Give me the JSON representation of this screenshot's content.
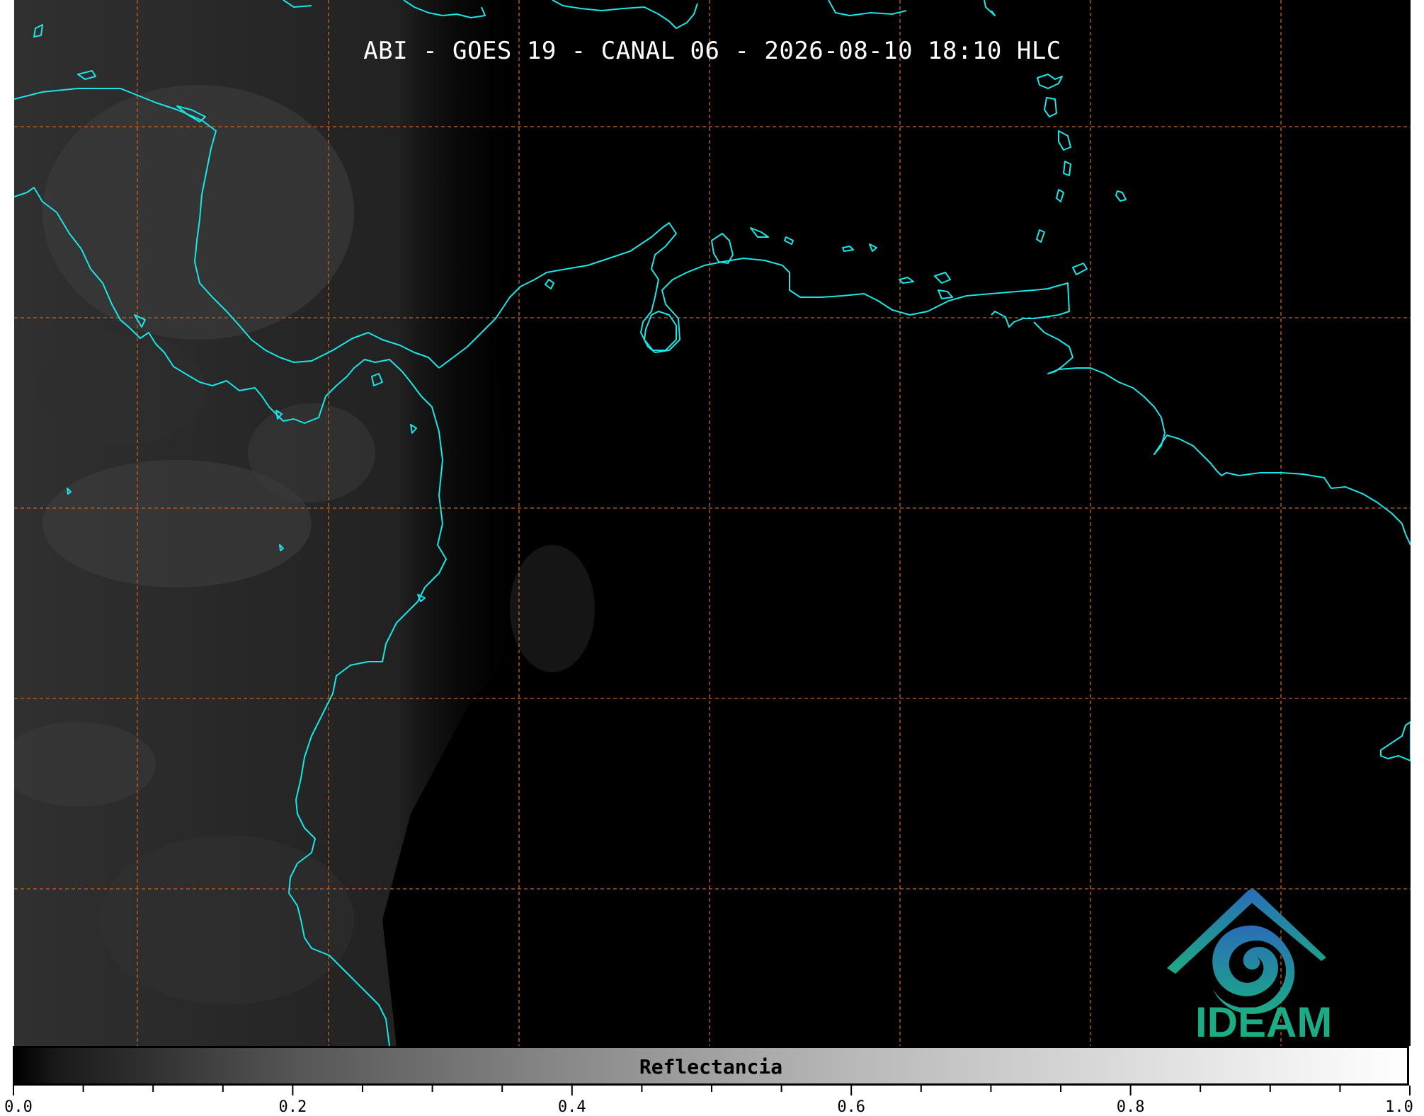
{
  "title": "ABI - GOES 19 - CANAL 06 - 2026-08-10 18:10 HLC",
  "colorbar": {
    "label": "Reflectancia",
    "range": [
      0.0,
      1.0
    ],
    "tick_labels": [
      "0.0",
      "0.2",
      "0.4",
      "0.6",
      "0.8",
      "1.0"
    ],
    "colors": [
      "#000000",
      "#ffffff"
    ]
  },
  "map": {
    "coastline_color": "#19e6e6",
    "graticule_color": "#c8621e",
    "graticule_style": "dashed"
  },
  "logo": {
    "text": "IDEAM",
    "colors": [
      "#2a7ab8",
      "#1cab84"
    ]
  }
}
